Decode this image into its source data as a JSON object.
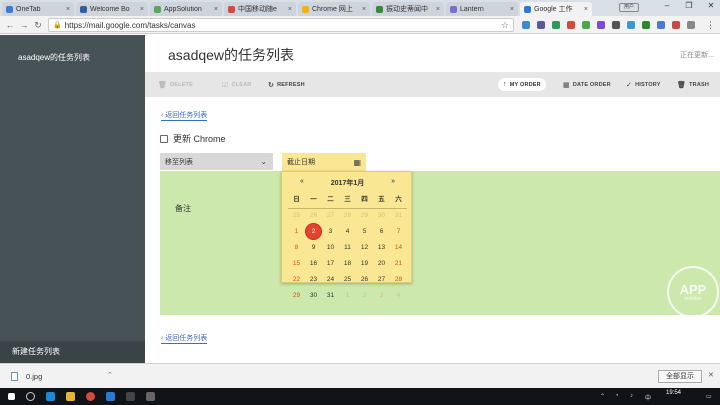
{
  "browser": {
    "tabs": [
      {
        "label": "OneTab",
        "color": "#3b7bd4"
      },
      {
        "label": "Welcome Bo",
        "color": "#2d5fa8"
      },
      {
        "label": "AppSolution",
        "color": "#5aa85a"
      },
      {
        "label": "中国移动随e",
        "color": "#d44"
      },
      {
        "label": "Chrome 网上",
        "color": "#f2b400"
      },
      {
        "label": "振动史蒂闻中",
        "color": "#3a8a3a"
      },
      {
        "label": "Lantern",
        "color": "#7a6cd4"
      },
      {
        "label": "Google 工作",
        "color": "#2a7ad4"
      }
    ],
    "url": "https://mail.google.com/tasks/canvas",
    "user_chip": "用户"
  },
  "sidebar": {
    "list_title": "asadqew的任务列表",
    "new_list": "新建任务列表"
  },
  "main": {
    "title": "asadqew的任务列表",
    "saving_status": "正在更新...",
    "actions": {
      "delete": "DELETE",
      "clear": "CLEAR",
      "refresh": "REFRESH",
      "my_order": "MY ORDER",
      "date_order": "DATE ORDER",
      "history": "HISTORY",
      "trash": "TRASH"
    },
    "back_link": "‹ 返回任务列表",
    "task_title": "更新 Chrome",
    "move_list": "移至列表",
    "due_date_placeholder": "截止日期",
    "notes_label": "备注"
  },
  "calendar": {
    "prev": "«",
    "next": "»",
    "month": "2017年1月",
    "weekdays": [
      "日",
      "一",
      "二",
      "三",
      "四",
      "五",
      "六"
    ],
    "weeks": [
      [
        "25",
        "26",
        "27",
        "28",
        "29",
        "30",
        "31"
      ],
      [
        "1",
        "2",
        "3",
        "4",
        "5",
        "6",
        "7"
      ],
      [
        "8",
        "9",
        "10",
        "11",
        "12",
        "13",
        "14"
      ],
      [
        "15",
        "16",
        "17",
        "18",
        "19",
        "20",
        "21"
      ],
      [
        "22",
        "23",
        "24",
        "25",
        "26",
        "27",
        "28"
      ],
      [
        "29",
        "30",
        "31",
        "1",
        "2",
        "3",
        "4"
      ]
    ],
    "selected_day": "2"
  },
  "watermark": {
    "line1": "APP",
    "line2": "solution"
  },
  "download": {
    "file_name": "0.jpg",
    "show_all": "全部显示"
  },
  "taskbar": {
    "time": "19:54"
  }
}
